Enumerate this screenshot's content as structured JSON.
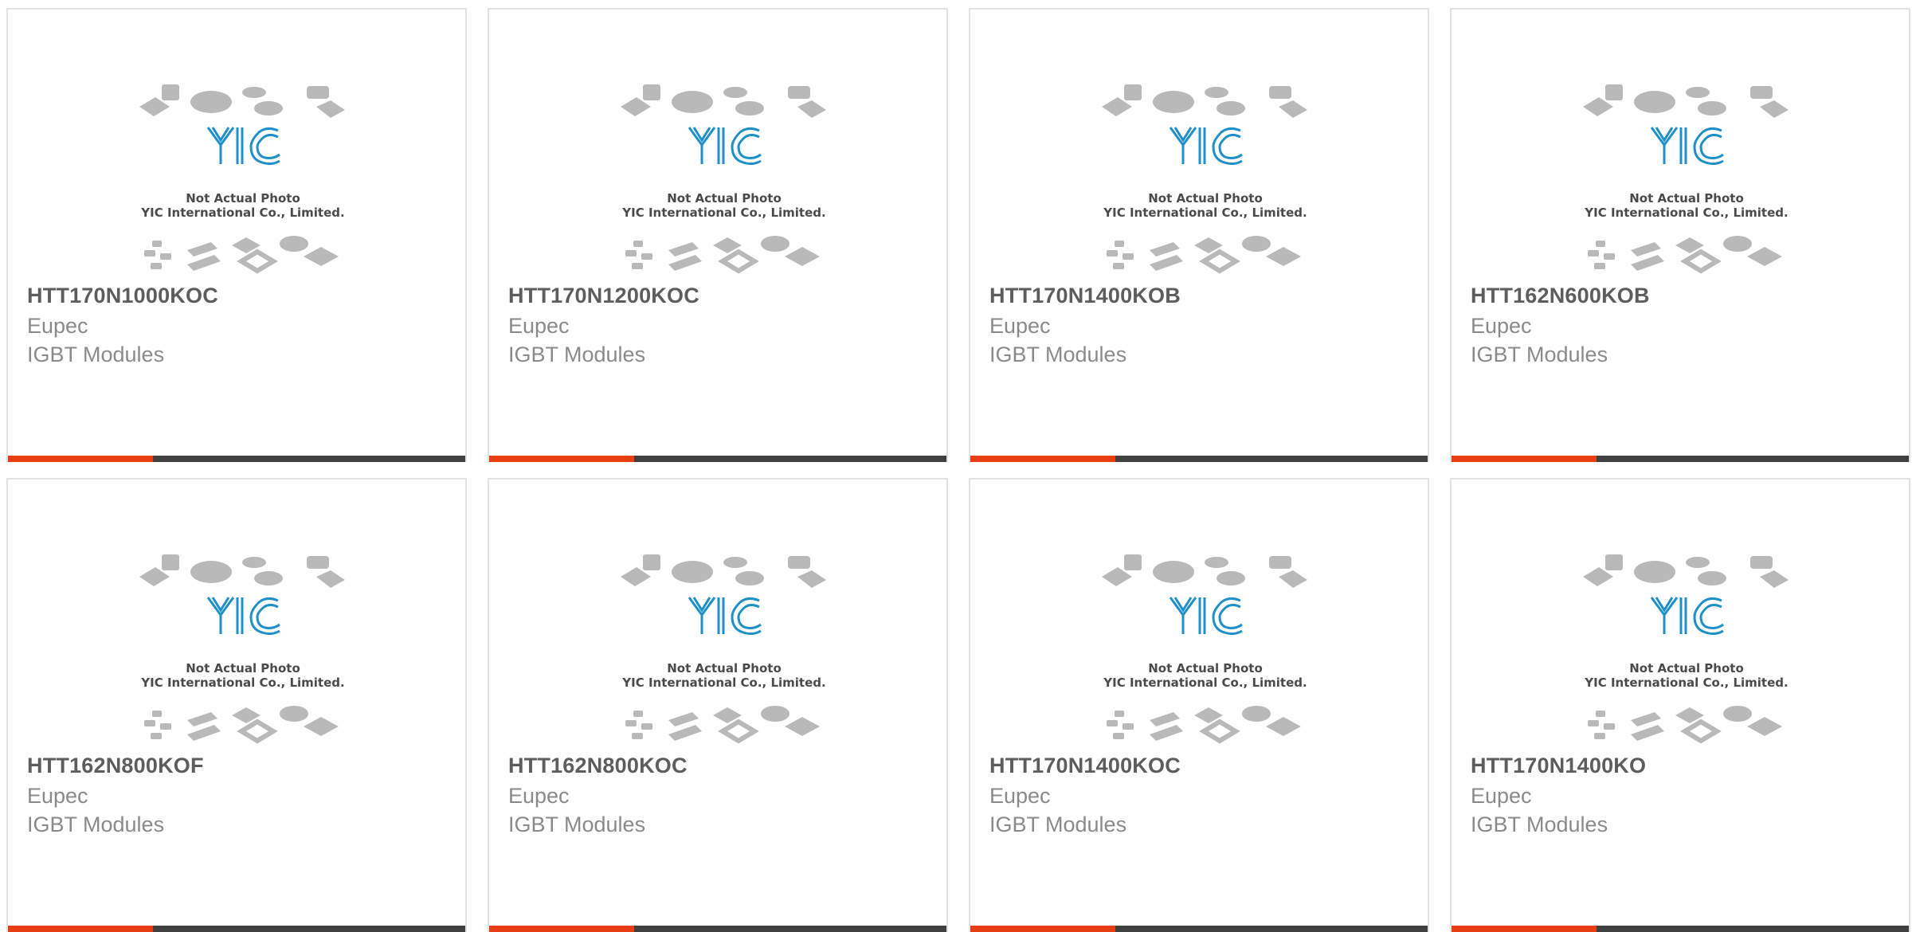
{
  "theme": {
    "accent_color": "#e63e12",
    "bar_color": "#3f3f3f",
    "logo_color": "#1f8fc8"
  },
  "placeholder": {
    "logo_text": "YIC",
    "line1": "Not Actual Photo",
    "line2": "YIC International Co., Limited."
  },
  "products": [
    {
      "part_number": "HTT170N1000KOC",
      "manufacturer": "Eupec",
      "category": "IGBT Modules"
    },
    {
      "part_number": "HTT170N1200KOC",
      "manufacturer": "Eupec",
      "category": "IGBT Modules"
    },
    {
      "part_number": "HTT170N1400KOB",
      "manufacturer": "Eupec",
      "category": "IGBT Modules"
    },
    {
      "part_number": "HTT162N600KOB",
      "manufacturer": "Eupec",
      "category": "IGBT Modules"
    },
    {
      "part_number": "HTT162N800KOF",
      "manufacturer": "Eupec",
      "category": "IGBT Modules"
    },
    {
      "part_number": "HTT162N800KOC",
      "manufacturer": "Eupec",
      "category": "IGBT Modules"
    },
    {
      "part_number": "HTT170N1400KOC",
      "manufacturer": "Eupec",
      "category": "IGBT Modules"
    },
    {
      "part_number": "HTT170N1400KO",
      "manufacturer": "Eupec",
      "category": "IGBT Modules"
    }
  ]
}
